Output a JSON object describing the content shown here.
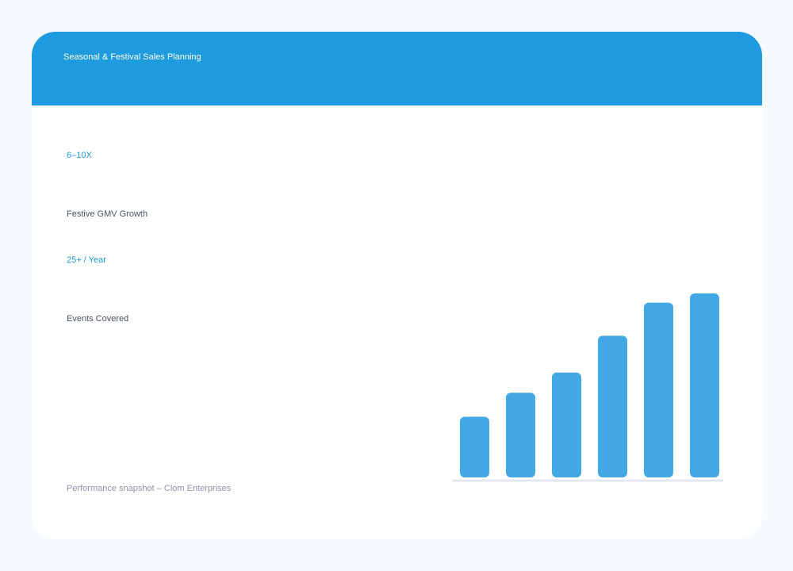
{
  "header": {
    "title": "Seasonal & Festival Sales Planning"
  },
  "stats": [
    {
      "value": "6–10X",
      "label": "Festive GMV Growth"
    },
    {
      "value": "25+ / Year",
      "label": "Events Covered"
    }
  ],
  "footer": {
    "note": "Performance snapshot – Clom Enterprises"
  },
  "colors": {
    "accent": "#1e9ade",
    "bar": "#43a9e4"
  },
  "chart_data": {
    "type": "bar",
    "categories": [],
    "values": [
      33,
      46,
      57,
      77,
      95,
      100
    ],
    "title": "",
    "xlabel": "",
    "ylabel": "",
    "ylim": [
      0,
      100
    ],
    "grid": false
  }
}
